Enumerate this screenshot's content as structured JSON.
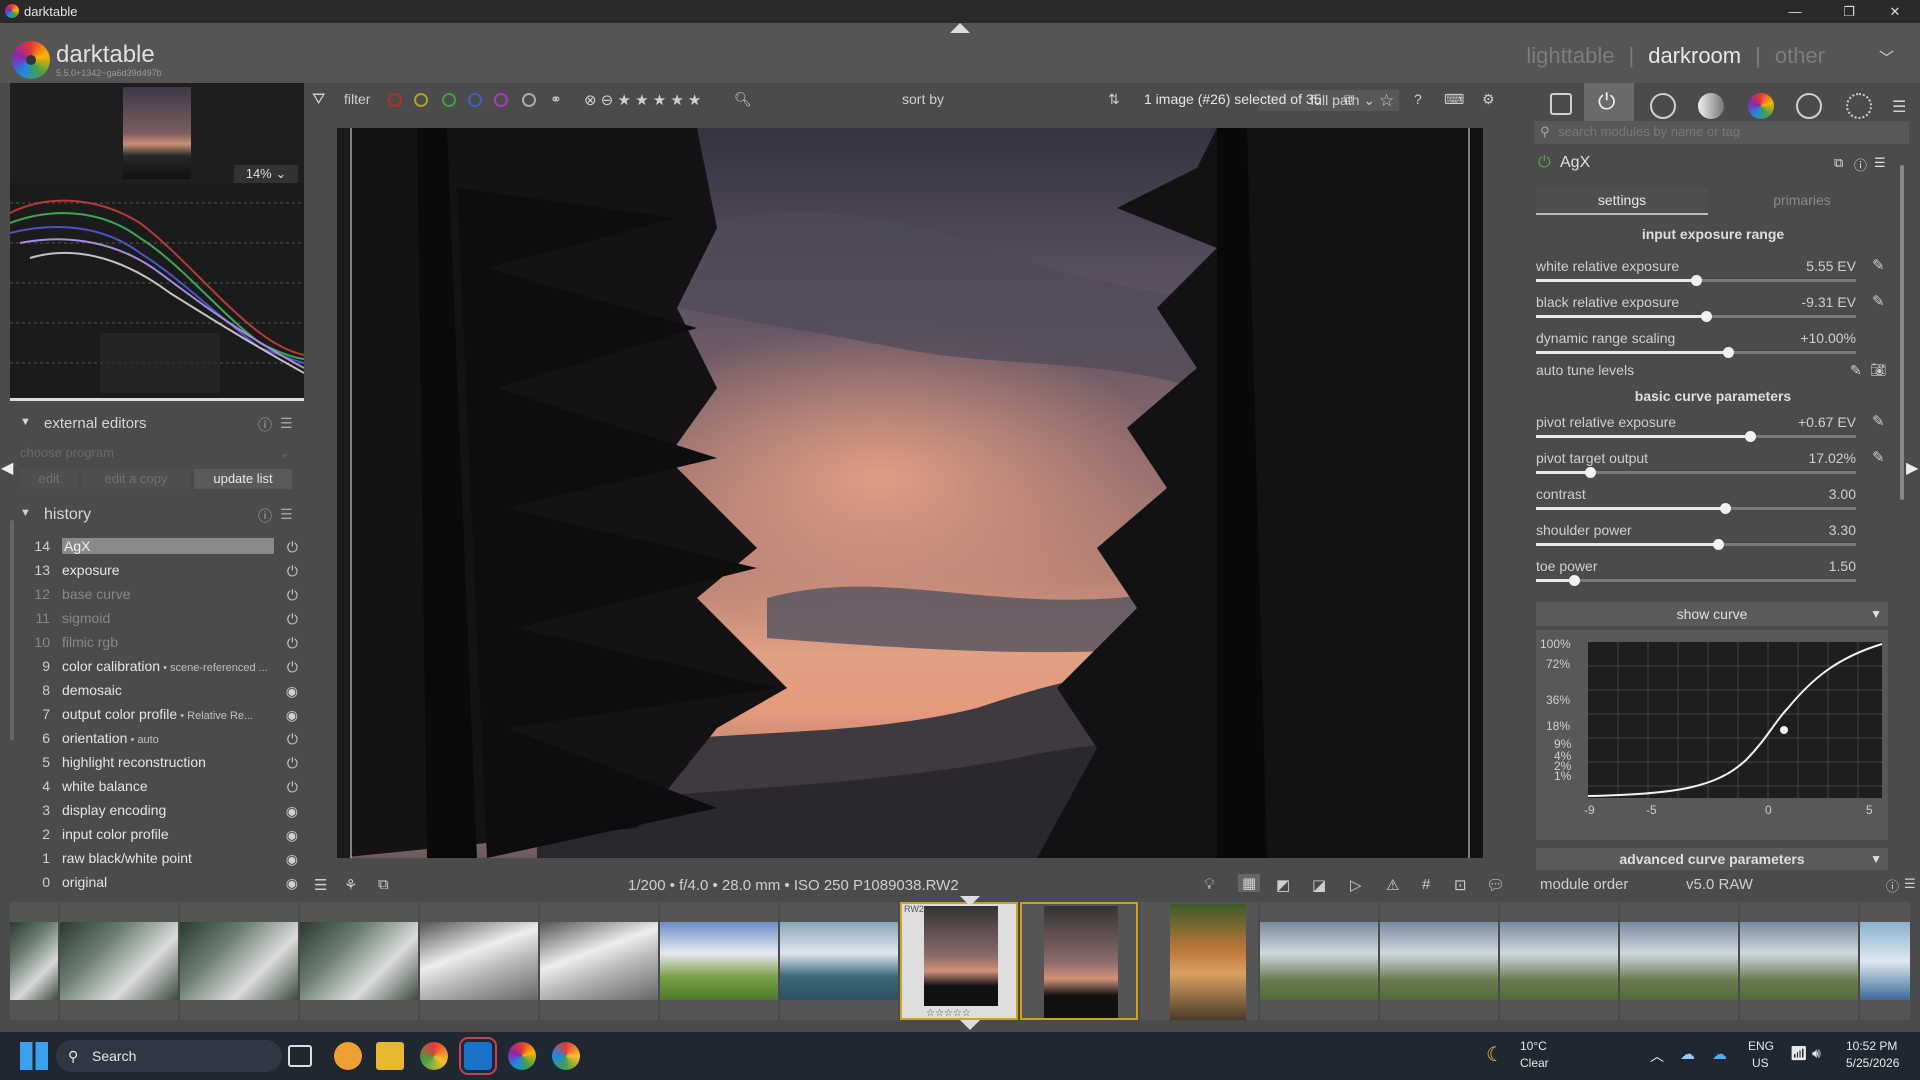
{
  "window": {
    "title": "darktable"
  },
  "header": {
    "app_name": "darktable",
    "version": "5.5.0+1342~ga6d39d497b",
    "views": [
      "lighttable",
      "darkroom",
      "other"
    ],
    "active_view": "darkroom"
  },
  "left_panel": {
    "zoom": "14%",
    "external_editors": {
      "title": "external editors",
      "choose_program": "choose program",
      "buttons": [
        "edit",
        "edit a copy",
        "update list"
      ]
    },
    "history": {
      "title": "history",
      "items": [
        {
          "num": "14",
          "label": "AgX",
          "detail": "",
          "state": "selected"
        },
        {
          "num": "13",
          "label": "exposure",
          "detail": "",
          "state": "on"
        },
        {
          "num": "12",
          "label": "base curve",
          "detail": "",
          "state": "off"
        },
        {
          "num": "11",
          "label": "sigmoid",
          "detail": "",
          "state": "off"
        },
        {
          "num": "10",
          "label": "filmic rgb",
          "detail": "",
          "state": "off"
        },
        {
          "num": "9",
          "label": "color calibration",
          "detail": " • scene-referenced ...",
          "state": "on"
        },
        {
          "num": "8",
          "label": "demosaic",
          "detail": "",
          "state": "always"
        },
        {
          "num": "7",
          "label": "output color profile",
          "detail": " • Relative Re...",
          "state": "always"
        },
        {
          "num": "6",
          "label": "orientation",
          "detail": " • auto",
          "state": "on"
        },
        {
          "num": "5",
          "label": "highlight reconstruction",
          "detail": "",
          "state": "on"
        },
        {
          "num": "4",
          "label": "white balance",
          "detail": "",
          "state": "on"
        },
        {
          "num": "3",
          "label": "display encoding",
          "detail": "",
          "state": "always"
        },
        {
          "num": "2",
          "label": "input color profile",
          "detail": "",
          "state": "always"
        },
        {
          "num": "1",
          "label": "raw black/white point",
          "detail": "",
          "state": "always"
        },
        {
          "num": "0",
          "label": "original",
          "detail": "",
          "state": "always"
        }
      ]
    }
  },
  "filter_bar": {
    "filter_label": "filter",
    "sort_label": "sort by",
    "sort_value": "full path",
    "selection": "1 image (#26) selected of 35"
  },
  "image_info": "1/200 • f/4.0 • 28.0 mm • ISO 250 P1089038.RW2",
  "right_panel": {
    "search_placeholder": "search modules by name or tag",
    "module": "AgX",
    "tabs": [
      "settings",
      "primaries"
    ],
    "active_tab": "settings",
    "sections": {
      "input": "input exposure range",
      "basic": "basic curve parameters",
      "advanced": "advanced curve parameters",
      "show_curve": "show curve"
    },
    "sliders": [
      {
        "label": "white relative exposure",
        "value": "5.55 EV",
        "pos": 0.5,
        "picker": true
      },
      {
        "label": "black relative exposure",
        "value": "-9.31 EV",
        "pos": 0.53,
        "picker": true
      },
      {
        "label": "dynamic range scaling",
        "value": "+10.00%",
        "pos": 0.6,
        "picker": false
      },
      {
        "label": "pivot relative exposure",
        "value": "+0.67 EV",
        "pos": 0.67,
        "picker": true
      },
      {
        "label": "pivot target output",
        "value": "17.02%",
        "pos": 0.17,
        "picker": true
      },
      {
        "label": "contrast",
        "value": "3.00",
        "pos": 0.59,
        "picker": false
      },
      {
        "label": "shoulder power",
        "value": "3.30",
        "pos": 0.57,
        "picker": false
      },
      {
        "label": "toe power",
        "value": "1.50",
        "pos": 0.12,
        "picker": false
      }
    ],
    "auto_tune": "auto tune levels",
    "curve": {
      "y_ticks": [
        "100%",
        "72%",
        "36%",
        "18%",
        "9%",
        "4%",
        "2%",
        "1%"
      ],
      "x_ticks": [
        "-9",
        "-5",
        "0",
        "5"
      ]
    },
    "module_order_label": "module order",
    "module_order_value": "v5.0 RAW"
  },
  "taskbar": {
    "search": "Search",
    "weather_temp": "10°C",
    "weather_cond": "Clear",
    "lang1": "ENG",
    "lang2": "US",
    "time": "10:52 PM",
    "date": "5/25/2026"
  },
  "colors": {
    "panel": "#4b4b4b",
    "header": "#555555",
    "text": "#c8c8c8",
    "accent": "#e8e8e8"
  }
}
